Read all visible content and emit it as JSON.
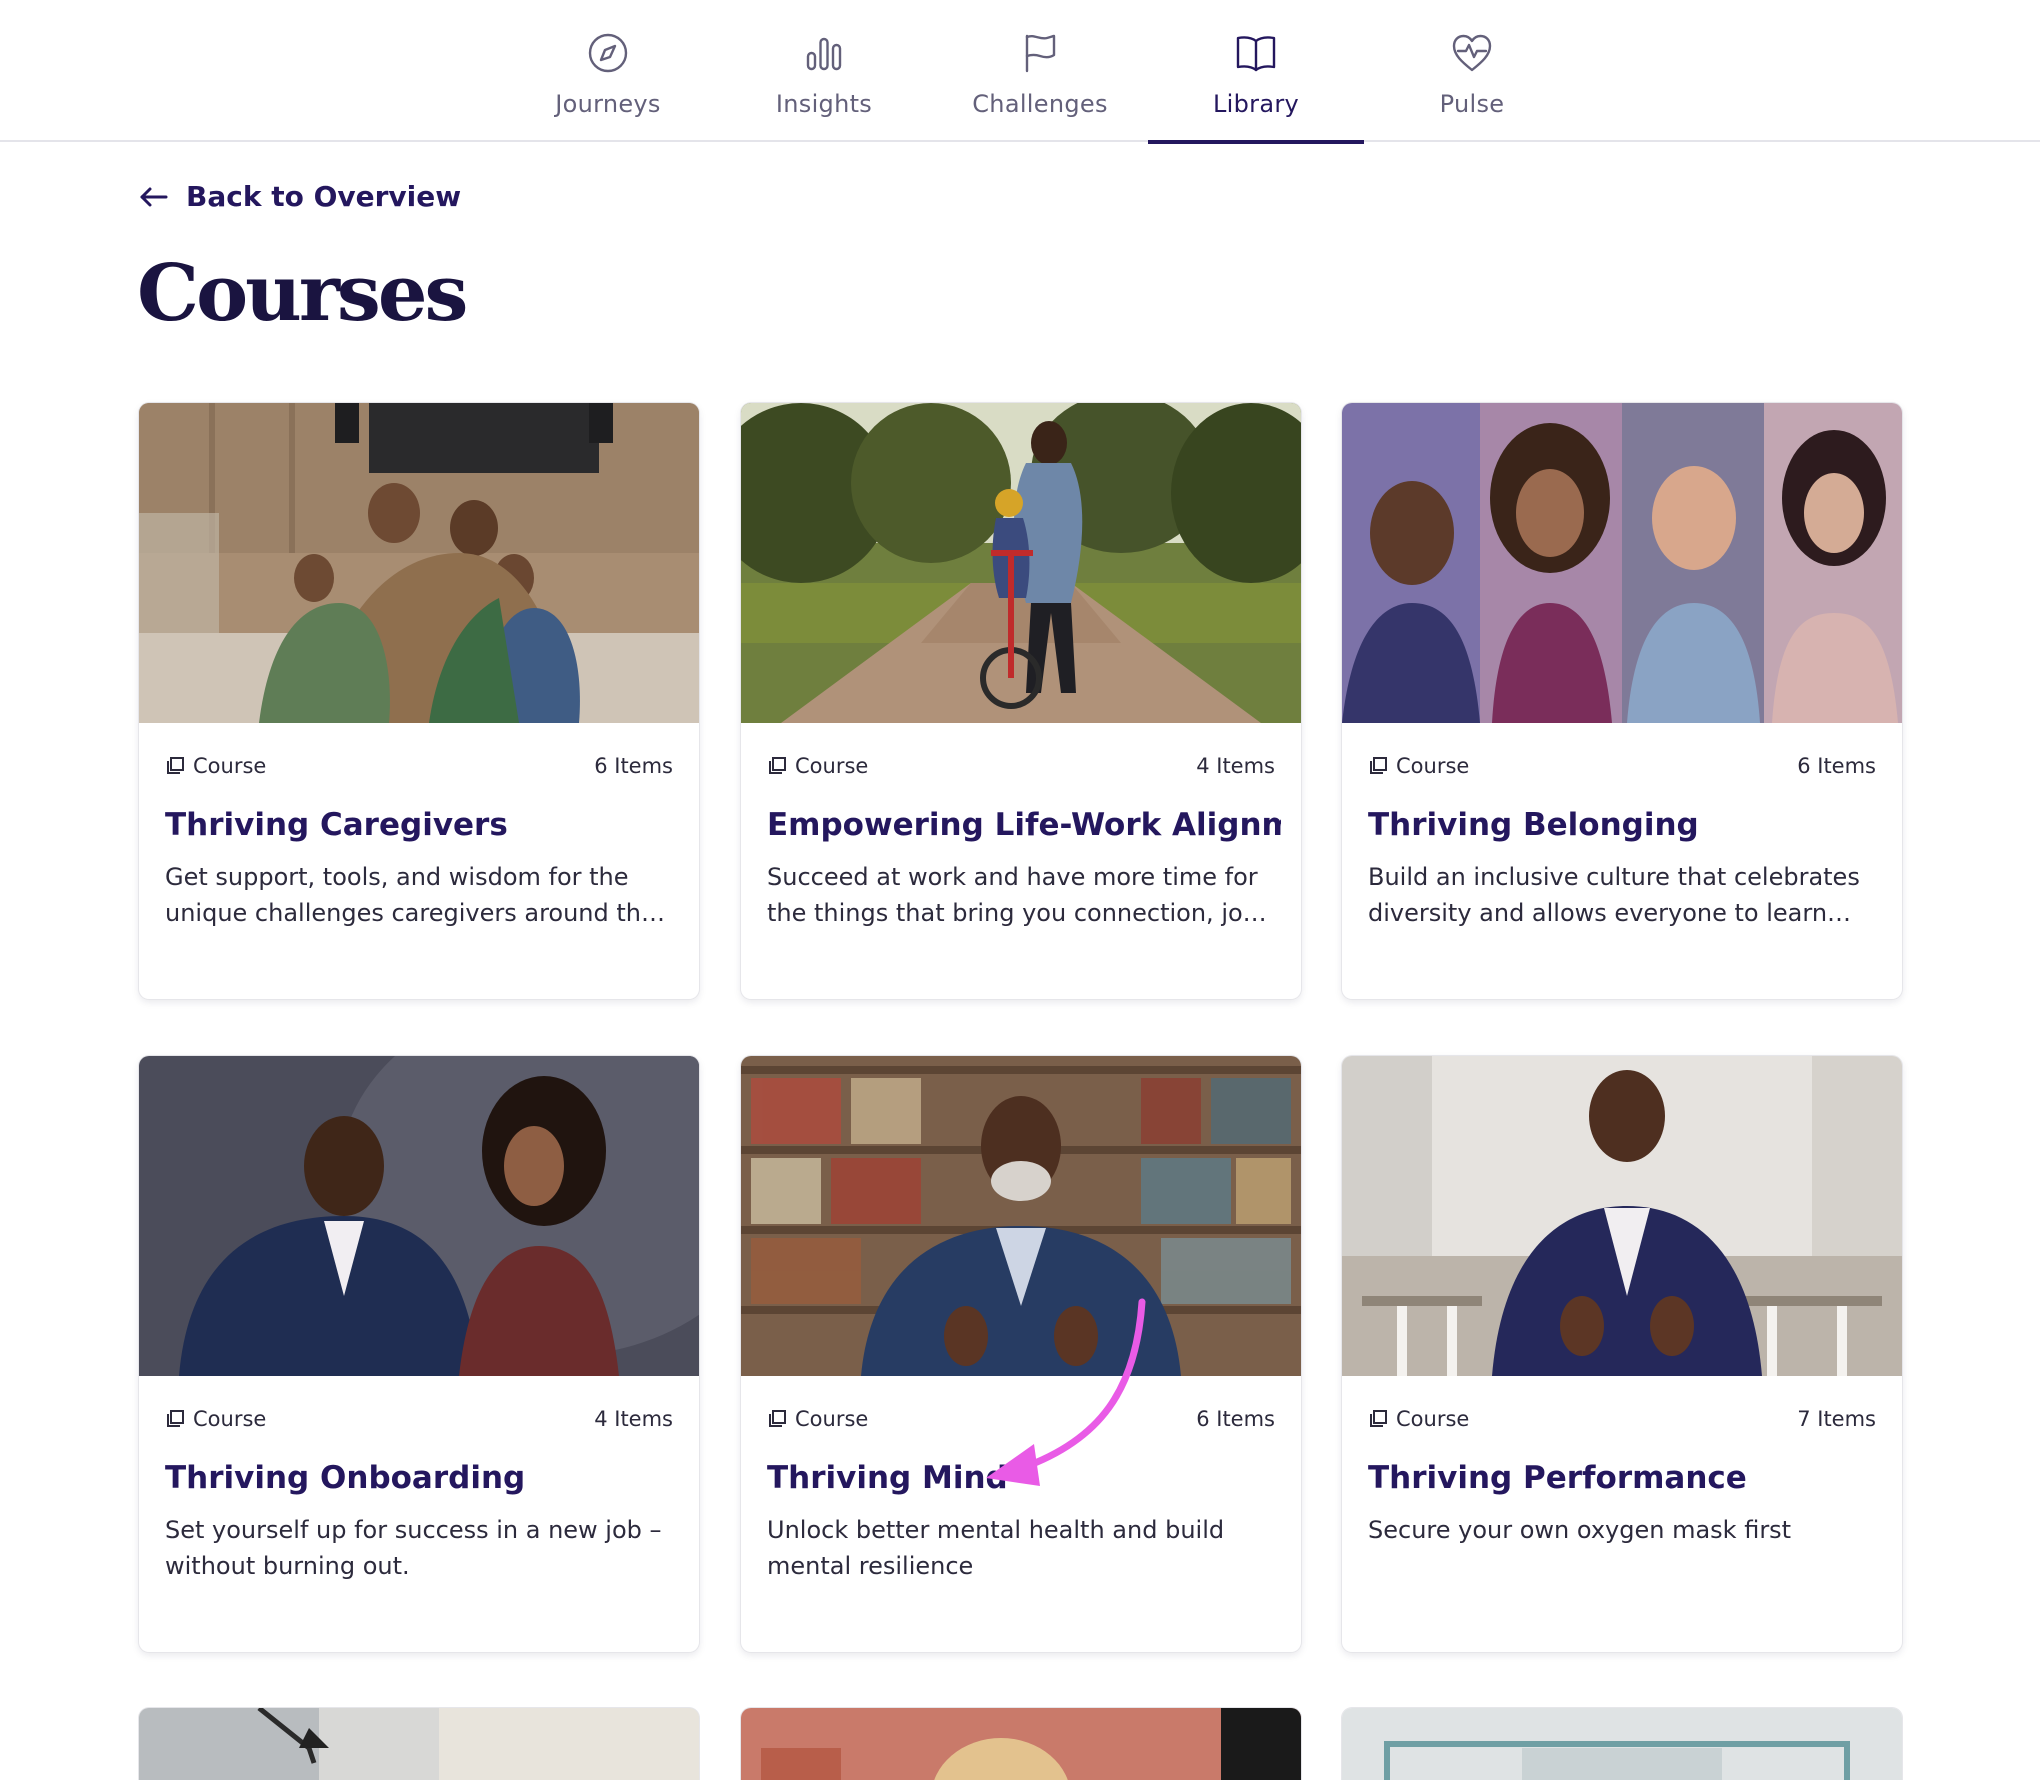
{
  "nav": {
    "tabs": [
      {
        "label": "Journeys",
        "icon": "compass-icon"
      },
      {
        "label": "Insights",
        "icon": "bar-chart-icon"
      },
      {
        "label": "Challenges",
        "icon": "flag-icon"
      },
      {
        "label": "Library",
        "icon": "book-icon",
        "active": true
      },
      {
        "label": "Pulse",
        "icon": "heart-pulse-icon"
      }
    ]
  },
  "back_label": "Back to Overview",
  "page_title": "Courses",
  "colors": {
    "accent": "#24175e",
    "annotation_arrow": "#e95be6"
  },
  "courses": [
    {
      "type": "Course",
      "items": "6 Items",
      "title": "Thriving Caregivers",
      "description": "Get support, tools, and wisdom for the unique challenges caregivers around the world face"
    },
    {
      "type": "Course",
      "items": "4 Items",
      "title": "Empowering Life-Work Alignment",
      "description": "Succeed at work and have more time for the things that bring you connection, joy and meaning"
    },
    {
      "type": "Course",
      "items": "6 Items",
      "title": "Thriving Belonging",
      "description": "Build an inclusive culture that celebrates diversity and allows everyone to learn and grow"
    },
    {
      "type": "Course",
      "items": "4 Items",
      "title": "Thriving Onboarding",
      "description": "Set yourself up for success in a new job – without burning out."
    },
    {
      "type": "Course",
      "items": "6 Items",
      "title": "Thriving Mind",
      "description": "Unlock better mental health and build mental resilience"
    },
    {
      "type": "Course",
      "items": "7 Items",
      "title": "Thriving Performance",
      "description": "Secure your own oxygen mask first"
    }
  ]
}
